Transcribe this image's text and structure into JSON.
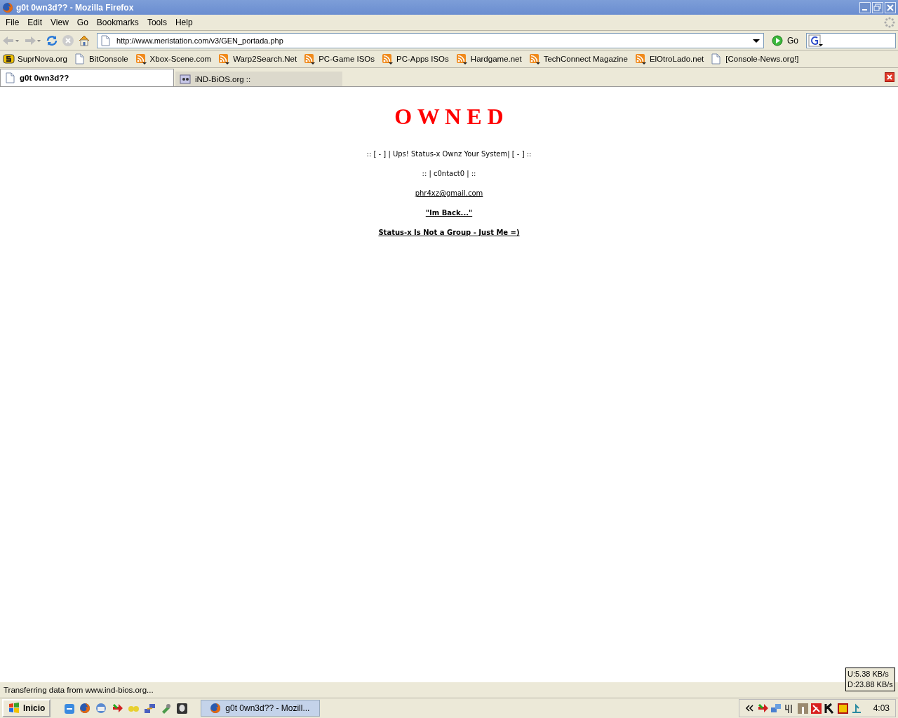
{
  "window": {
    "title": "g0t 0wn3d?? - Mozilla Firefox"
  },
  "menu": [
    "File",
    "Edit",
    "View",
    "Go",
    "Bookmarks",
    "Tools",
    "Help"
  ],
  "address": {
    "value": "http://www.meristation.com/v3/GEN_portada.php",
    "go": "Go"
  },
  "bookmarks": [
    {
      "label": "SuprNova.org",
      "kind": "logo"
    },
    {
      "label": "BitConsole",
      "kind": "page"
    },
    {
      "label": "Xbox-Scene.com",
      "kind": "feed"
    },
    {
      "label": "Warp2Search.Net",
      "kind": "feed"
    },
    {
      "label": "PC-Game ISOs",
      "kind": "feed"
    },
    {
      "label": "PC-Apps ISOs",
      "kind": "feed"
    },
    {
      "label": "Hardgame.net",
      "kind": "feed"
    },
    {
      "label": "TechConnect Magazine",
      "kind": "feed"
    },
    {
      "label": "ElOtroLado.net",
      "kind": "feed"
    },
    {
      "label": "[Console-News.org!]",
      "kind": "page"
    }
  ],
  "tabs": [
    {
      "label": "g0t 0wn3d??",
      "selected": true
    },
    {
      "label": "iND-BiOS.org ::",
      "selected": false
    }
  ],
  "page": {
    "heading": "O W N E D",
    "lines": [
      {
        "text": ":: [ - ] | Ups! Status-x Ownz Your System| [ - ] ::",
        "kind": "plain"
      },
      {
        "text": ":: | c0ntact0 | ::",
        "kind": "plain"
      },
      {
        "text": "phr4xz@gmail.com",
        "kind": "link"
      },
      {
        "text": "\"Im Back...\"",
        "kind": "bold"
      },
      {
        "text": "Status-x Is Not a Group - Just Me =)",
        "kind": "bold"
      }
    ]
  },
  "status_bar": {
    "text": "Transferring data from www.ind-bios.org..."
  },
  "speed_meter": {
    "upload": "U:5.38 KB/s",
    "download": "D:23.88 KB/s"
  },
  "taskbar": {
    "start": "Inicio",
    "task": "g0t 0wn3d?? - Mozill...",
    "clock": "4:03"
  }
}
